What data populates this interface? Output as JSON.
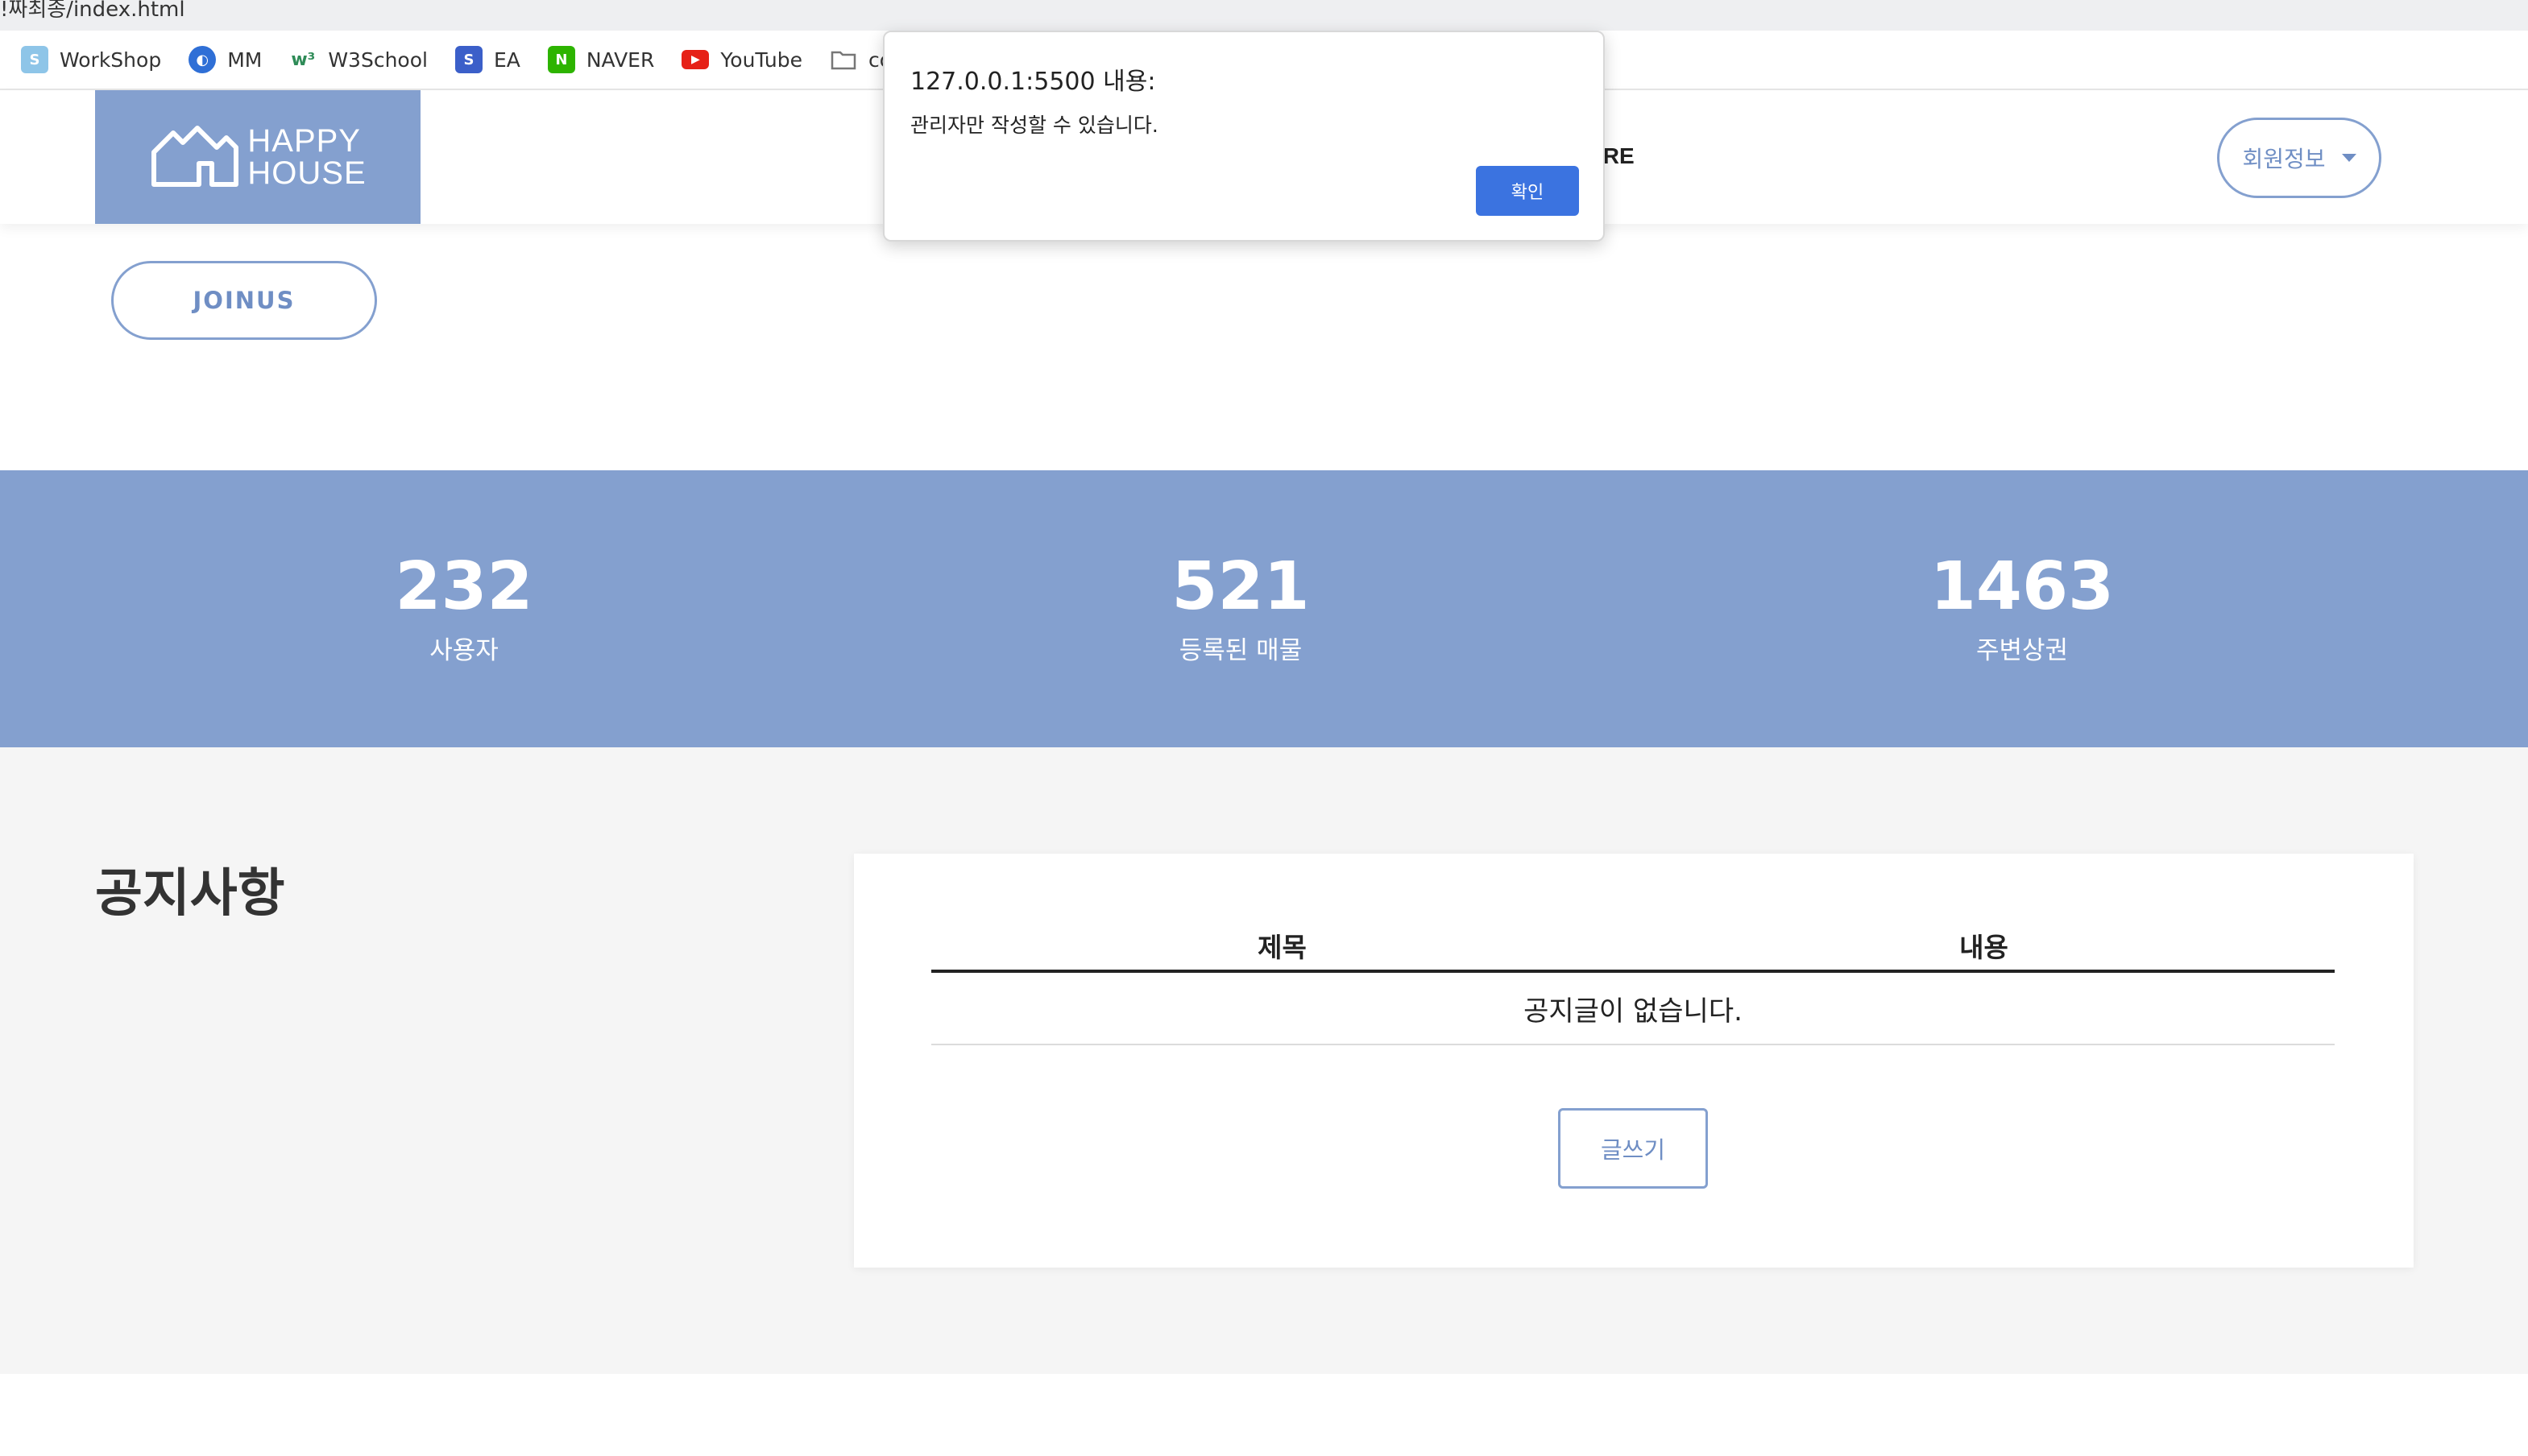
{
  "browser": {
    "url_fragment": "!짜최종/index.html",
    "bookmarks": [
      {
        "label": "WorkShop",
        "icon": "workshop-icon",
        "color": "#8ec5e8",
        "glyph": "S"
      },
      {
        "label": "MM",
        "icon": "mm-icon",
        "color": "#2f6fd6",
        "glyph": "◐"
      },
      {
        "label": "W3School",
        "icon": "w3school-icon",
        "color": "#2e8b57",
        "glyph": "w³"
      },
      {
        "label": "EA",
        "icon": "ea-icon",
        "color": "#3b5fc9",
        "glyph": "S"
      },
      {
        "label": "NAVER",
        "icon": "naver-icon",
        "color": "#2db400",
        "glyph": "N"
      },
      {
        "label": "YouTube",
        "icon": "youtube-icon",
        "color": "#e62117",
        "glyph": "▶"
      },
      {
        "label": "codir",
        "icon": "folder-icon",
        "color": "#8a8a8a",
        "glyph": "▭"
      }
    ]
  },
  "navbar": {
    "logo_line1": "HAPPY",
    "logo_line2": "HOUSE",
    "more_partial": "ORE",
    "member_label": "회원정보"
  },
  "joinus_label": "JOINUS",
  "stats": [
    {
      "value": "232",
      "label": "사용자"
    },
    {
      "value": "521",
      "label": "등록된 매물"
    },
    {
      "value": "1463",
      "label": "주변상권"
    }
  ],
  "notice": {
    "title": "공지사항",
    "columns": [
      "제목",
      "내용"
    ],
    "empty_message": "공지글이 없습니다.",
    "write_label": "글쓰기"
  },
  "dialog": {
    "title": "127.0.0.1:5500 내용:",
    "message": "관리자만 작성할 수 있습니다.",
    "ok_label": "확인"
  },
  "colors": {
    "brand": "#84a0cf",
    "dialog_button": "#3b73e0"
  }
}
